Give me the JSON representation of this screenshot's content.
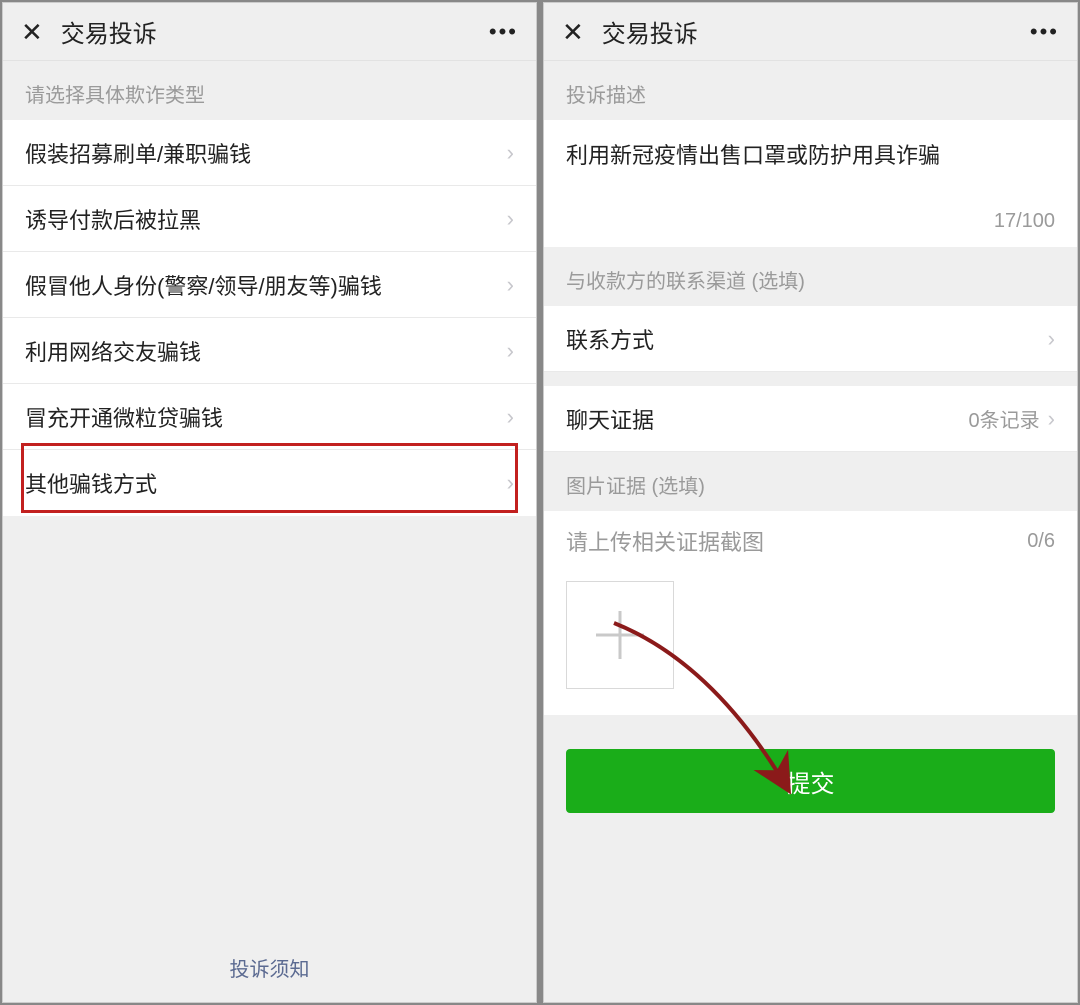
{
  "left": {
    "nav": {
      "title": "交易投诉"
    },
    "section_label": "请选择具体欺诈类型",
    "items": [
      "假装招募刷单/兼职骗钱",
      "诱导付款后被拉黑",
      "假冒他人身份(警察/领导/朋友等)骗钱",
      "利用网络交友骗钱",
      "冒充开通微粒贷骗钱",
      "其他骗钱方式"
    ],
    "footer": "投诉须知"
  },
  "right": {
    "nav": {
      "title": "交易投诉"
    },
    "desc_label": "投诉描述",
    "desc_text": "利用新冠疫情出售口罩或防护用具诈骗",
    "desc_count": "17/100",
    "contact_label": "与收款方的联系渠道 (选填)",
    "contact_cell": "联系方式",
    "chat_cell": "聊天证据",
    "chat_value": "0条记录",
    "img_label": "图片证据 (选填)",
    "upload_hint": "请上传相关证据截图",
    "upload_count": "0/6",
    "submit": "提交"
  }
}
